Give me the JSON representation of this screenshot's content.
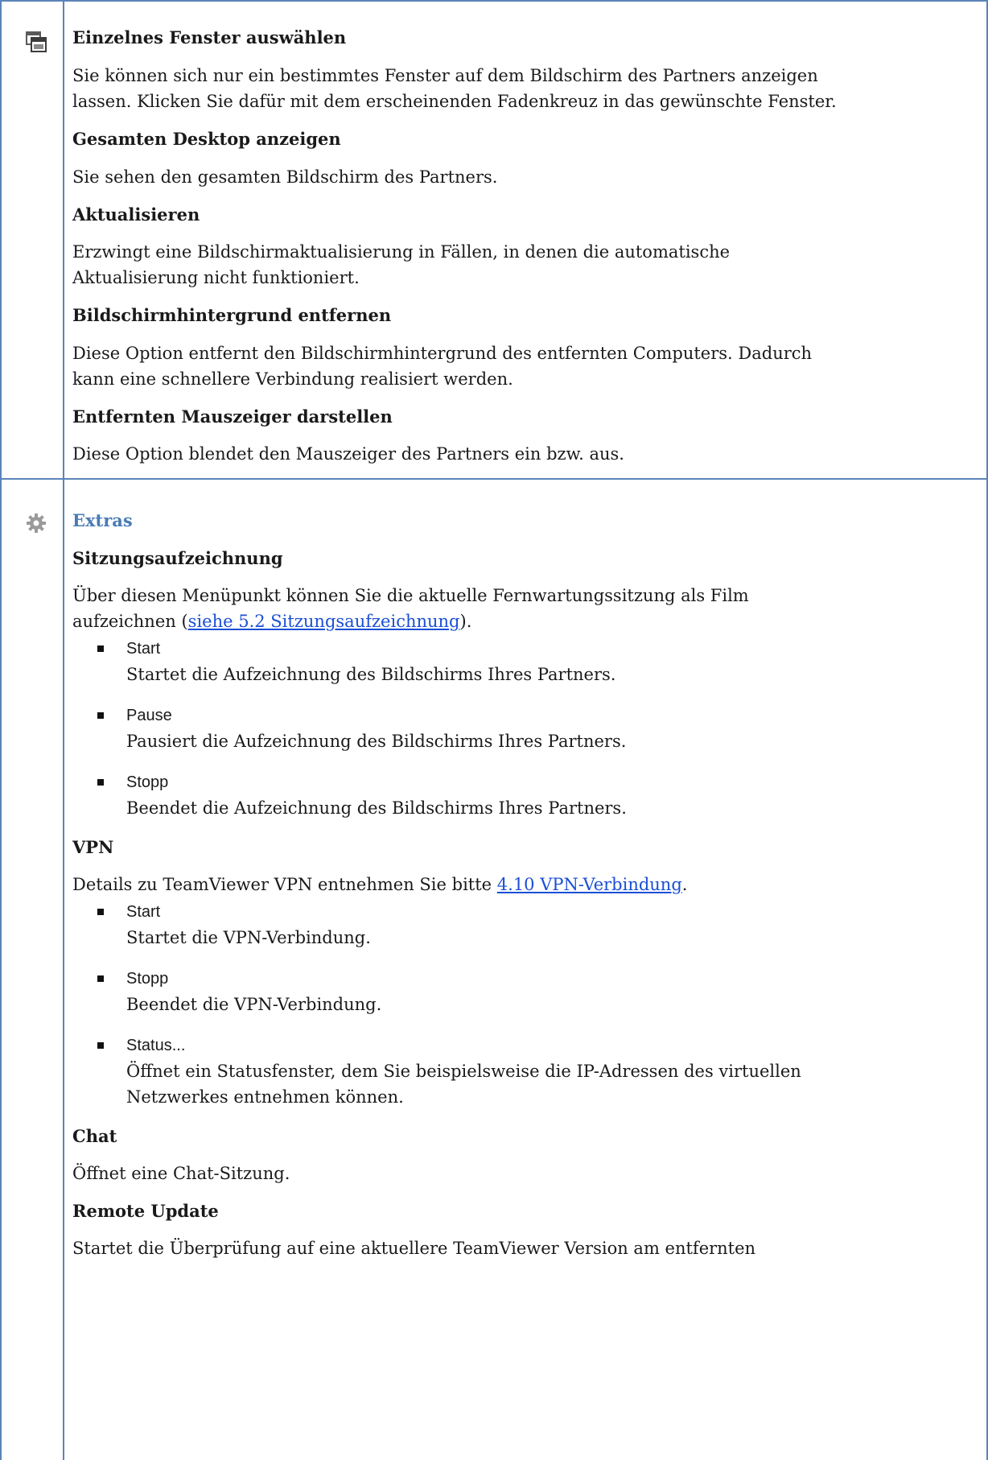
{
  "colors": {
    "rule": "#5b84b8",
    "section_heading": "#4a7bb5",
    "link": "#1a4fd6"
  },
  "section_view": {
    "icon": "window-icon",
    "select_window_title": "Einzelnes Fenster auswählen",
    "select_window_line1": "Sie können sich nur ein bestimmtes Fenster auf dem Bildschirm des Partners anzeigen",
    "select_window_line2": "lassen. Klicken Sie dafür mit dem erscheinenden Fadenkreuz in das gewünschte Fenster.",
    "full_desktop_title": "Gesamten Desktop anzeigen",
    "full_desktop_text": "Sie sehen den gesamten Bildschirm des Partners.",
    "refresh_title": "Aktualisieren",
    "refresh_line1": "Erzwingt eine Bildschirmaktualisierung in Fällen, in denen die automatische",
    "refresh_line2": "Aktualisierung nicht funktioniert.",
    "wallpaper_title": "Bildschirmhintergrund entfernen",
    "wallpaper_line1": "Diese Option entfernt den Bildschirmhintergrund des entfernten Computers. Dadurch",
    "wallpaper_line2": "kann eine schnellere Verbindung realisiert werden.",
    "cursor_title": "Entfernten Mauszeiger darstellen",
    "cursor_text": "Diese Option blendet den Mauszeiger des Partners ein bzw. aus."
  },
  "section_extras": {
    "icon": "gear-icon",
    "heading": "Extras",
    "recording_title": "Sitzungsaufzeichnung",
    "recording_line1": "Über diesen Menüpunkt können Sie die aktuelle Fernwartungssitzung als Film",
    "recording_line2_pre": "aufzeichnen (",
    "recording_link": "siehe 5.2 Sitzungsaufzeichnung",
    "recording_line2_post": ").",
    "recording_items": [
      {
        "title": "Start",
        "desc": "Startet die Aufzeichnung des Bildschirms Ihres Partners."
      },
      {
        "title": "Pause",
        "desc": "Pausiert die Aufzeichnung des Bildschirms Ihres Partners."
      },
      {
        "title": "Stopp",
        "desc": "Beendet die Aufzeichnung des Bildschirms Ihres Partners."
      }
    ],
    "vpn_title": "VPN",
    "vpn_line_pre": "Details zu TeamViewer VPN entnehmen Sie bitte ",
    "vpn_link": "4.10 VPN-Verbindung",
    "vpn_line_post": ".",
    "vpn_items": [
      {
        "title": "Start",
        "desc": "Startet die VPN-Verbindung."
      },
      {
        "title": "Stopp",
        "desc": "Beendet die VPN-Verbindung."
      },
      {
        "title": "Status...",
        "desc": "Öffnet ein Statusfenster, dem Sie beispielsweise die IP-Adressen des virtuellen",
        "desc2": "Netzwerkes entnehmen können."
      }
    ],
    "chat_title": "Chat",
    "chat_text": "Öffnet eine Chat-Sitzung.",
    "update_title": "Remote Update",
    "update_text": "Startet die Überprüfung auf eine aktuellere TeamViewer Version  am entfernten"
  }
}
